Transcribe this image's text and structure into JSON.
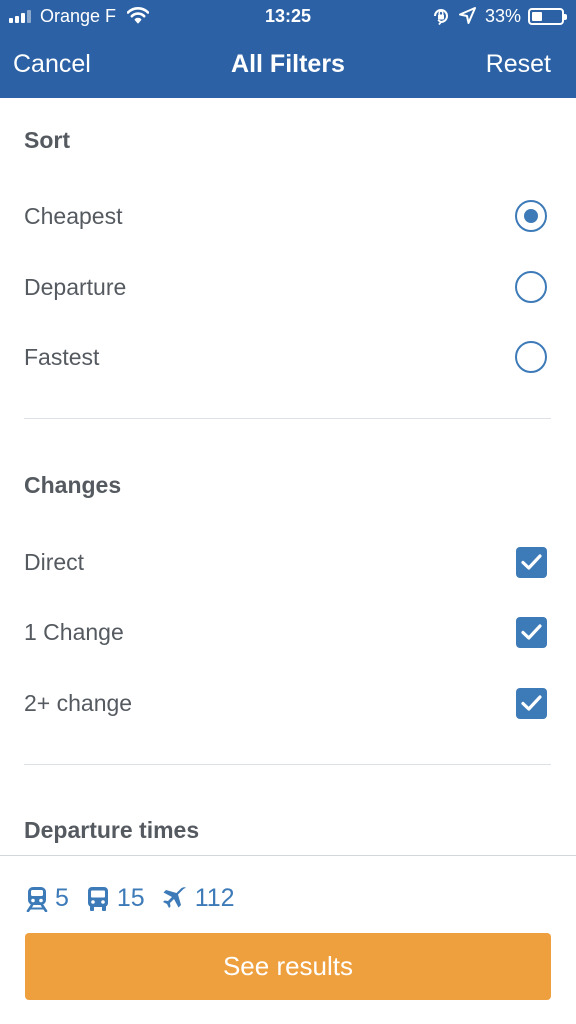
{
  "status_bar": {
    "carrier": "Orange F",
    "time": "13:25",
    "battery": "33%"
  },
  "nav": {
    "cancel_label": "Cancel",
    "title": "All Filters",
    "reset_label": "Reset"
  },
  "sort": {
    "title": "Sort",
    "options": [
      {
        "label": "Cheapest",
        "selected": true
      },
      {
        "label": "Departure",
        "selected": false
      },
      {
        "label": "Fastest",
        "selected": false
      }
    ]
  },
  "changes": {
    "title": "Changes",
    "options": [
      {
        "label": "Direct",
        "checked": true
      },
      {
        "label": "1 Change",
        "checked": true
      },
      {
        "label": "2+ change",
        "checked": true
      }
    ]
  },
  "departure_times": {
    "title": "Departure times"
  },
  "footer": {
    "train_count": "5",
    "bus_count": "15",
    "flight_count": "112",
    "see_results_label": "See results"
  },
  "colors": {
    "header_bg": "#2c62a5",
    "accent": "#3d7ab8",
    "cta": "#efa03e"
  },
  "icons": [
    "signal-icon",
    "wifi-icon",
    "orientation-lock-icon",
    "location-arrow-icon",
    "battery-icon",
    "train-icon",
    "bus-icon",
    "plane-icon",
    "checkmark-icon"
  ]
}
